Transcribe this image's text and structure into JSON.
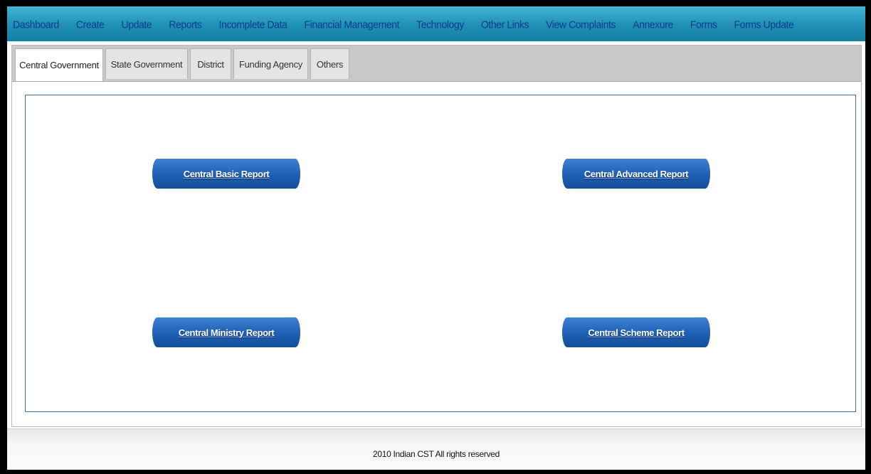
{
  "topnav": {
    "items": [
      {
        "label": "Dashboard"
      },
      {
        "label": "Create"
      },
      {
        "label": "Update"
      },
      {
        "label": "Reports"
      },
      {
        "label": "Incomplete Data"
      },
      {
        "label": "Financial Management"
      },
      {
        "label": "Technology"
      },
      {
        "label": "Other Links"
      },
      {
        "label": "View Complaints"
      },
      {
        "label": "Annexure"
      },
      {
        "label": "Forms"
      },
      {
        "label": "Forms Update"
      }
    ]
  },
  "tabs": {
    "active": "Central Government",
    "items": [
      {
        "label": "Central Government"
      },
      {
        "label": "State Government"
      },
      {
        "label": "District"
      },
      {
        "label": "Funding Agency"
      },
      {
        "label": "Others"
      }
    ]
  },
  "reports": {
    "basic": "Central Basic Report",
    "advanced": "Central Advanced Report",
    "ministry": "Central Ministry Report",
    "scheme": "Central Scheme Report"
  },
  "footer": {
    "copyright": "2010 Indian CST All rights reserved"
  },
  "colors": {
    "nav_bar": "#1f8fb3",
    "nav_text": "#0a3d8f",
    "button": "#1d5fb3",
    "content_border": "#4a6f95"
  }
}
